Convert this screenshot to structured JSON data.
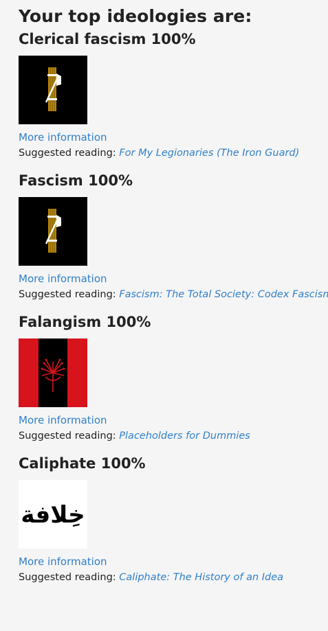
{
  "page": {
    "title": "Your top ideologies are:"
  },
  "colors": {
    "link": "#2f7fc8",
    "text": "#222222",
    "background": "#f5f5f5"
  },
  "results": [
    {
      "title": "Clerical fascism 100%",
      "image_icon": "fasces-flag-icon",
      "more_info": "More information",
      "reading_label": "Suggested reading:",
      "reading_title": "For My Legionaries (The Iron Guard)"
    },
    {
      "title": "Fascism 100%",
      "image_icon": "fasces-flag-icon",
      "more_info": "More information",
      "reading_label": "Suggested reading:",
      "reading_title": "Fascism: The Total Society: Codex Fascismo"
    },
    {
      "title": "Falangism 100%",
      "image_icon": "falange-flag-icon",
      "more_info": "More information",
      "reading_label": "Suggested reading:",
      "reading_title": "Placeholders for Dummies"
    },
    {
      "title": "Caliphate 100%",
      "image_icon": "caliphate-calligraphy-icon",
      "image_text": "خِلافة",
      "more_info": "More information",
      "reading_label": "Suggested reading:",
      "reading_title": "Caliphate: The History of an Idea"
    }
  ]
}
